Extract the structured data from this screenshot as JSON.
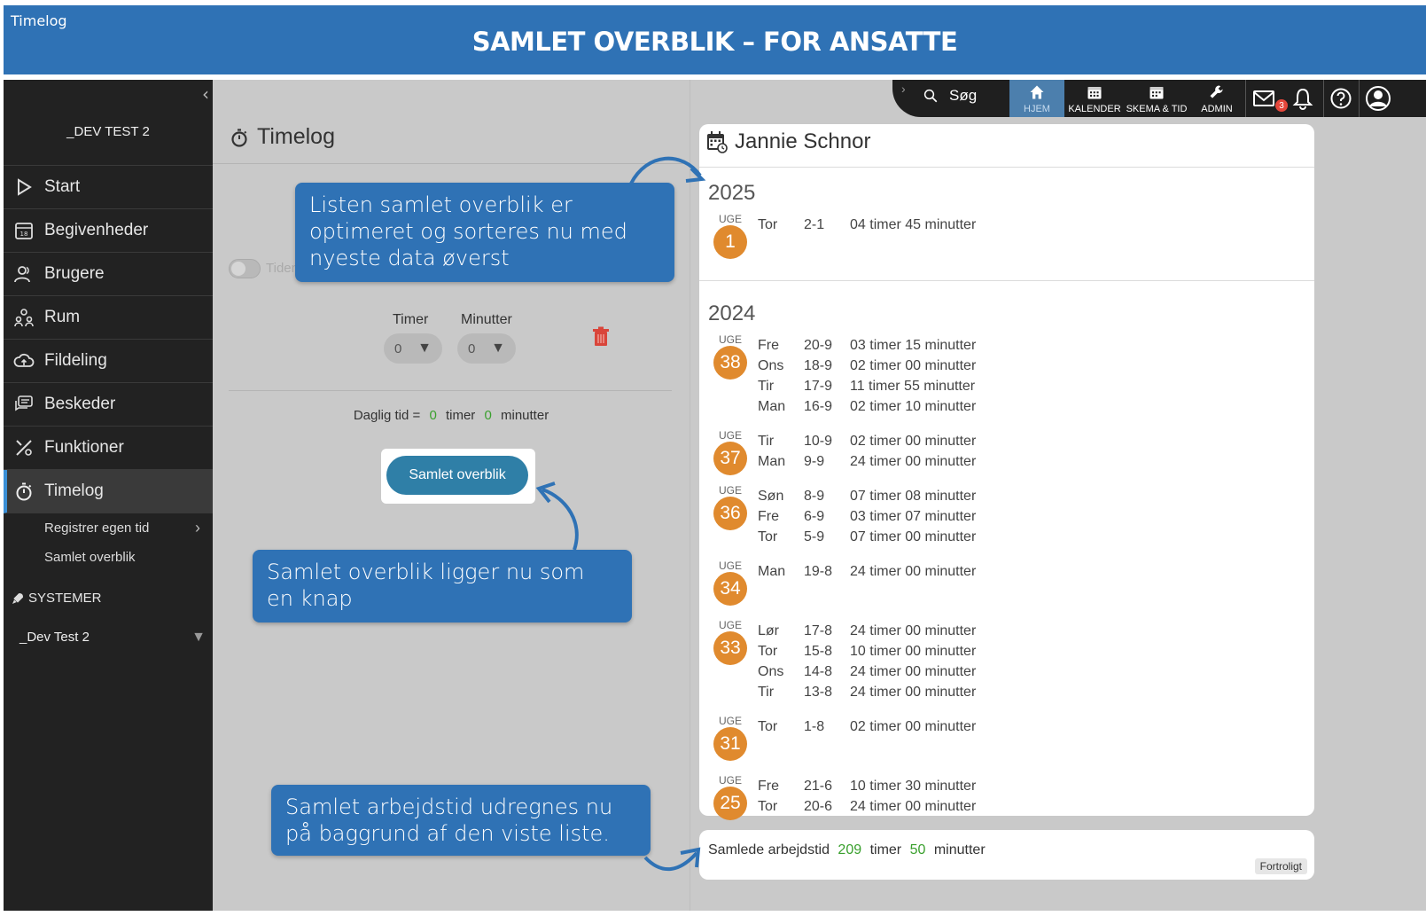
{
  "banner": {
    "tag": "Timelog",
    "title": "SAMLET OVERBLIK – FOR ANSATTE"
  },
  "sidebar": {
    "brand": "_DEV TEST 2",
    "items": [
      {
        "label": "Start",
        "icon": "play-icon"
      },
      {
        "label": "Begivenheder",
        "icon": "calendar-icon"
      },
      {
        "label": "Brugere",
        "icon": "users-icon"
      },
      {
        "label": "Rum",
        "icon": "room-icon"
      },
      {
        "label": "Fildeling",
        "icon": "cloud-icon"
      },
      {
        "label": "Beskeder",
        "icon": "messages-icon"
      },
      {
        "label": "Funktioner",
        "icon": "tools-icon"
      },
      {
        "label": "Timelog",
        "icon": "stopwatch-icon"
      }
    ],
    "sub": [
      "Registrer egen tid",
      "Samlet overblik"
    ],
    "systems": "SYSTEMER",
    "system_select": "_Dev Test 2"
  },
  "middle": {
    "title": "Timelog",
    "toggle_label": "Tiden",
    "timer_label": "Timer",
    "minutter_label": "Minutter",
    "timer_value": "0",
    "minutter_value": "0",
    "daily_prefix": "Daglig tid =",
    "daily_hours": "0",
    "daily_timer": "timer",
    "daily_minutes": "0",
    "daily_minutter": "minutter",
    "button": "Samlet overblik"
  },
  "topnav": {
    "search": "Søg",
    "items": [
      "HJEM",
      "KALENDER",
      "SKEMA & TID",
      "ADMIN"
    ],
    "mail_badge": "3"
  },
  "card": {
    "name": "Jannie Schnor",
    "uge": "UGE",
    "years": [
      {
        "year": "2025",
        "weeks": [
          {
            "week": "1",
            "rows": [
              [
                "Tor",
                "2-1",
                "04 timer 45 minutter"
              ]
            ]
          }
        ]
      },
      {
        "year": "2024",
        "weeks": [
          {
            "week": "38",
            "rows": [
              [
                "Fre",
                "20-9",
                "03 timer 15 minutter"
              ],
              [
                "Ons",
                "18-9",
                "02 timer 00 minutter"
              ],
              [
                "Tir",
                "17-9",
                "11 timer 55 minutter"
              ],
              [
                "Man",
                "16-9",
                "02 timer 10 minutter"
              ]
            ]
          },
          {
            "week": "37",
            "rows": [
              [
                "Tir",
                "10-9",
                "02 timer 00 minutter"
              ],
              [
                "Man",
                "9-9",
                "24 timer 00 minutter"
              ]
            ]
          },
          {
            "week": "36",
            "rows": [
              [
                "Søn",
                "8-9",
                "07 timer 08 minutter"
              ],
              [
                "Fre",
                "6-9",
                "03 timer 07 minutter"
              ],
              [
                "Tor",
                "5-9",
                "07 timer 00 minutter"
              ]
            ]
          },
          {
            "week": "34",
            "rows": [
              [
                "Man",
                "19-8",
                "24 timer 00 minutter"
              ]
            ]
          },
          {
            "week": "33",
            "rows": [
              [
                "Lør",
                "17-8",
                "24 timer 00 minutter"
              ],
              [
                "Tor",
                "15-8",
                "10 timer 00 minutter"
              ],
              [
                "Ons",
                "14-8",
                "24 timer 00 minutter"
              ],
              [
                "Tir",
                "13-8",
                "24 timer 00 minutter"
              ]
            ]
          },
          {
            "week": "31",
            "rows": [
              [
                "Tor",
                "1-8",
                "02 timer 00 minutter"
              ]
            ]
          },
          {
            "week": "25",
            "rows": [
              [
                "Fre",
                "21-6",
                "10 timer 30 minutter"
              ],
              [
                "Tor",
                "20-6",
                "24 timer 00 minutter"
              ]
            ]
          }
        ]
      }
    ]
  },
  "total": {
    "prefix": "Samlede arbejdstid",
    "hours": "209",
    "timer": "timer",
    "minutes": "50",
    "minutter": "minutter",
    "fortrolig": "Fortroligt"
  },
  "callouts": {
    "sorted": "Listen samlet overblik er optimeret og sorteres nu med nyeste data øverst",
    "button": "Samlet overblik ligger nu som en knap",
    "total": "Samlet arbejdstid udregnes nu på baggrund af den viste liste."
  },
  "colors": {
    "banner": "#2f72b5",
    "week_badge": "#e08a2e",
    "green_value": "#3aa02e",
    "button": "#2f7fa7"
  }
}
